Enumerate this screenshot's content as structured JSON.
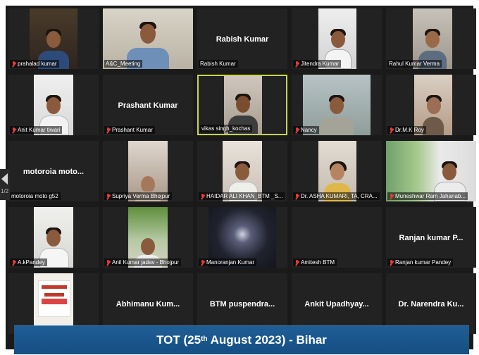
{
  "pagination": {
    "indicator": "1/2"
  },
  "banner": {
    "prefix": "TOT (25",
    "sup": "th",
    "suffix": " August 2023) - Bihar"
  },
  "participants": [
    {
      "label": "prahalad kumar",
      "muted": true
    },
    {
      "label": "A&C_Meeting",
      "muted": false
    },
    {
      "label": "Rabish Kumar",
      "center_name": "Rabish Kumar",
      "muted": false
    },
    {
      "label": "Jitendra Kumar",
      "muted": true
    },
    {
      "label": "Rahul Kumar Verma",
      "muted": false
    },
    {
      "label": "Anit Kumar tiwari",
      "muted": true
    },
    {
      "label": "Prashant Kumar",
      "center_name": "Prashant Kumar",
      "muted": true
    },
    {
      "label": "vikas singh_kochas",
      "muted": false,
      "speaking": true
    },
    {
      "label": "Nancy",
      "muted": true
    },
    {
      "label": "Dr.M.K Roy",
      "muted": true
    },
    {
      "label": "motoroia moto g52",
      "center_name": "motoroia moto...",
      "muted": false
    },
    {
      "label": "Supriya Verma Bhojpur",
      "muted": true
    },
    {
      "label": "HAIDAR ALI KHAN_BTM _S...",
      "muted": true
    },
    {
      "label": "Dr. ASHA KUMARI, TA, CRA...",
      "muted": true
    },
    {
      "label": "Muneshwar Ram Jahanab...",
      "muted": true
    },
    {
      "label": "A.kPandey",
      "muted": true
    },
    {
      "label": "Anil Kumar jadav - Bhojpur",
      "muted": true
    },
    {
      "label": "Manoranjan Kumar",
      "muted": true
    },
    {
      "label": "Amitesh BTM",
      "muted": true
    },
    {
      "label": "Ranjan kumar Pandey",
      "center_name": "Ranjan kumar P...",
      "muted": true
    },
    {
      "label": "",
      "muted": false
    },
    {
      "label": "",
      "center_name": "Abhimanu Kum...",
      "muted": false
    },
    {
      "label": "",
      "center_name": "BTM puspendra...",
      "muted": false
    },
    {
      "label": "",
      "center_name": "Ankit Upadhyay...",
      "muted": false
    },
    {
      "label": "",
      "center_name": "Dr. Narendra Ku...",
      "muted": false
    }
  ]
}
